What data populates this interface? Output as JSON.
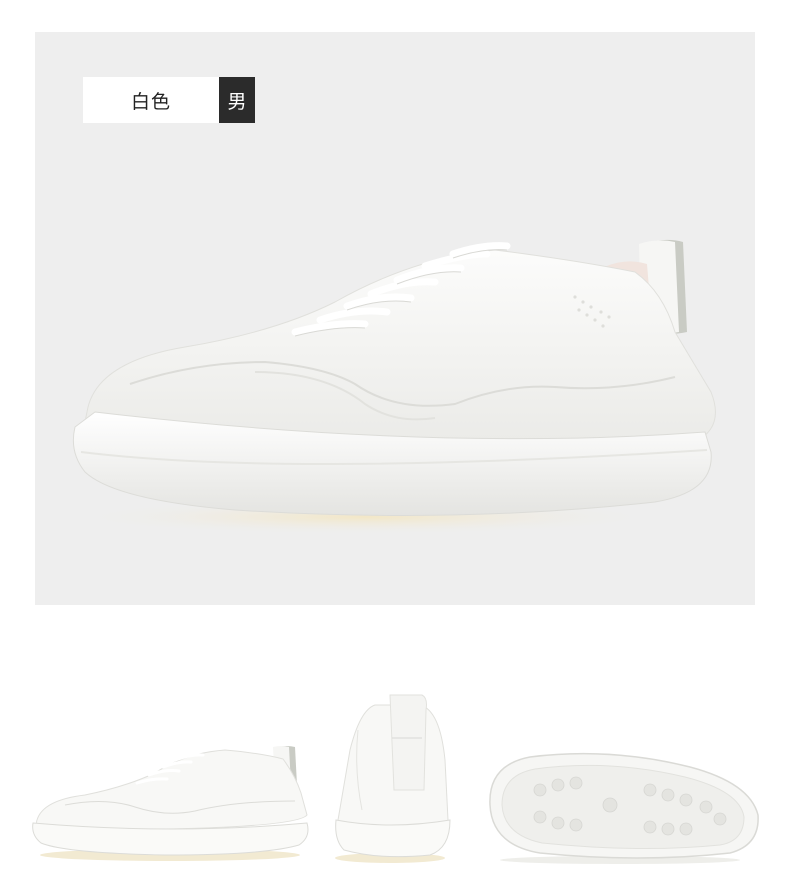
{
  "hero": {
    "tag_color_label": "白色",
    "tag_gender_label": "男",
    "image": "white-sneaker-side-view"
  },
  "thumbnails": [
    {
      "image": "white-sneaker-side-view"
    },
    {
      "image": "white-sneaker-back-view"
    },
    {
      "image": "white-sneaker-sole-view"
    }
  ],
  "colors": {
    "hero_background": "#eeeeee",
    "tag_label_bg": "#ffffff",
    "tag_gender_bg": "#2b2b2b",
    "shoe_white": "#f7f7f5",
    "heel_tab_grey": "#c9cbc4"
  }
}
